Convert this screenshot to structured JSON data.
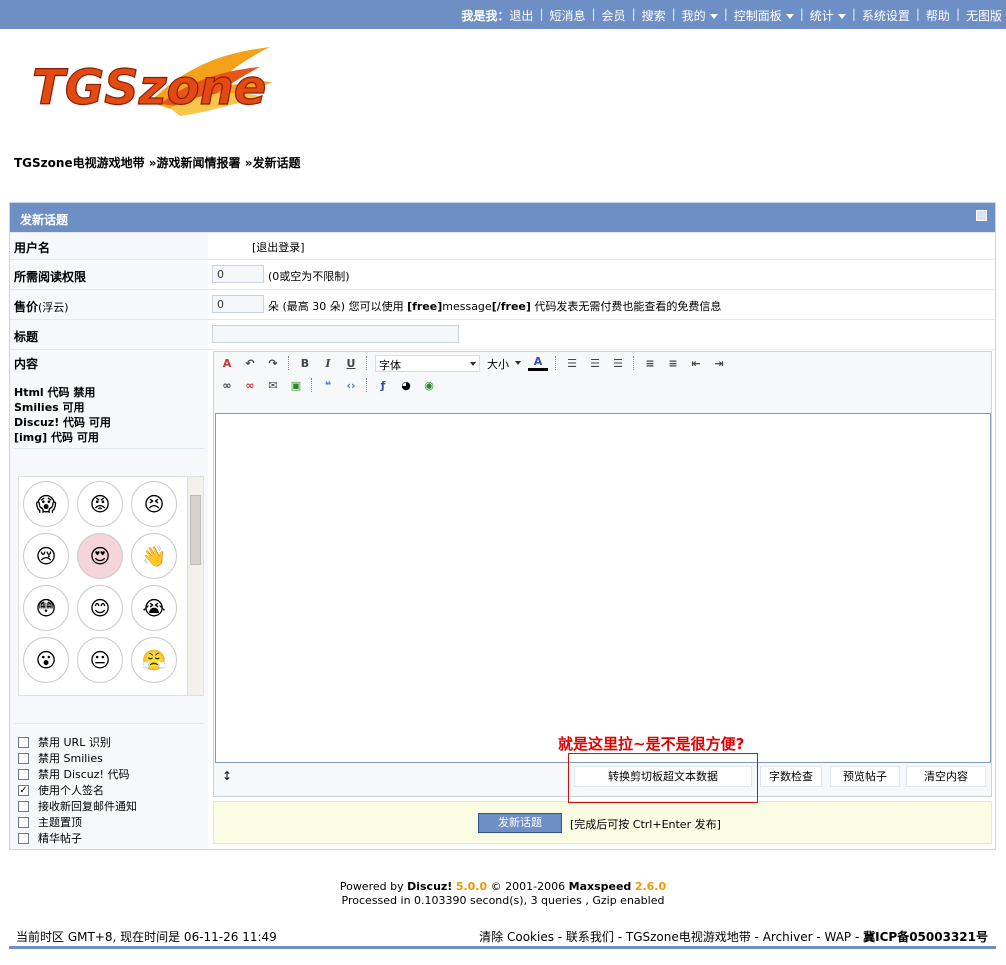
{
  "topnav": {
    "user": "我是我：",
    "items": [
      "退出",
      "短消息",
      "会员",
      "搜索",
      "我的",
      "控制面板",
      "统计",
      "系统设置",
      "帮助",
      "无图版"
    ]
  },
  "logo": {
    "text": "TGSzone"
  },
  "breadcrumb": {
    "forum": "TGSzone电视游戏地带",
    "board": "游戏新闻情报署",
    "current": "发新话题"
  },
  "panel": {
    "title": "发新话题",
    "username_label": "用户名",
    "logout_link": "[退出登录]",
    "read_perm_label": "所需阅读权限",
    "read_perm_value": "0",
    "read_perm_hint": "(0或空为不限制)",
    "price_label": "售价",
    "price_unit_label": "(浮云)",
    "price_value": "0",
    "price_hint_1": "朵 (最高 30 朵) 您可以使用 ",
    "price_hint_code1": "[free]",
    "price_hint_2": "message",
    "price_hint_code2": "[/free]",
    "price_hint_3": " 代码发表无需付费也能查看的免费信息",
    "subject_label": "标题",
    "subject_value": "",
    "content_label": "内容",
    "rules": [
      "Html 代码 禁用",
      "Smilies 可用",
      "Discuz! 代码 可用",
      "[img] 代码 可用"
    ],
    "font_select": "字体",
    "size_select": "大小",
    "options": [
      {
        "label": "禁用 URL 识别",
        "checked": false
      },
      {
        "label": "禁用 Smilies",
        "checked": false
      },
      {
        "label": "禁用 Discuz! 代码",
        "checked": false
      },
      {
        "label": "使用个人签名",
        "checked": true
      },
      {
        "label": "接收新回复邮件通知",
        "checked": false
      },
      {
        "label": "主题置顶",
        "checked": false
      },
      {
        "label": "精华帖子",
        "checked": false
      }
    ],
    "resize_glyph": "↕",
    "btn_convert": "转换剪切板超文本数据",
    "btn_count": "字数检查",
    "btn_preview": "预览帖子",
    "btn_clear": "清空内容",
    "btn_submit": "发新话题",
    "submit_hint": "[完成后可按 Ctrl+Enter 发布]"
  },
  "annotation": "就是这里拉~是不是很方便?",
  "footer": {
    "powered": "Powered by ",
    "discuz": "Discuz!",
    "discuz_ver": "5.0.0",
    "copyright": " © 2001-2006 ",
    "maxspeed": "Maxspeed",
    "maxspeed_ver": "2.6.0",
    "processed": "Processed in 0.103390 second(s), 3 queries , Gzip enabled",
    "timezone": "当前时区 GMT+8, 现在时间是 06-11-26 11:49",
    "links": "清除 Cookies - 联系我们 - TGSzone电视游戏地带 - Archiver - WAP - ",
    "icp": "冀ICP备05003321号"
  },
  "colors": {
    "accent": "#6e8fc6",
    "annotation": "#e00000"
  }
}
